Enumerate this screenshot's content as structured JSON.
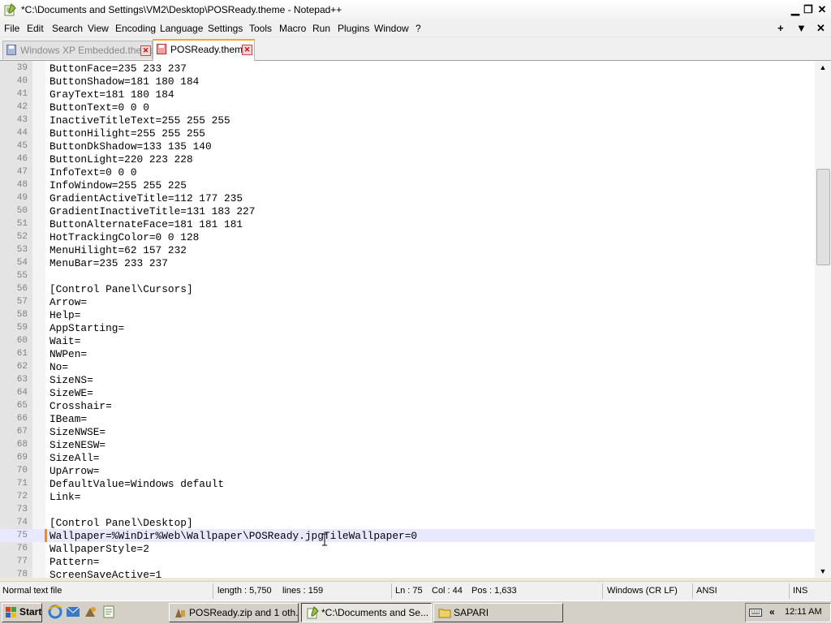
{
  "window": {
    "title": "*C:\\Documents and Settings\\VM2\\Desktop\\POSReady.theme - Notepad++",
    "minimize_icon": "minimize-icon",
    "restore_icon": "restore-icon",
    "close_icon": "close-icon"
  },
  "menu": {
    "items": [
      "File",
      "Edit",
      "Search",
      "View",
      "Encoding",
      "Language",
      "Settings",
      "Tools",
      "Macro",
      "Run",
      "Plugins",
      "Window",
      "?"
    ],
    "right_icons": [
      "plus-icon",
      "down-triangle-icon",
      "close-icon"
    ]
  },
  "tabs": [
    {
      "label": "Windows XP Embedded.theme",
      "active": false
    },
    {
      "label": "POSReady.theme",
      "active": true
    }
  ],
  "editor": {
    "current_line": 75,
    "lines": [
      {
        "n": "39",
        "text": "ButtonFace=235 233 237"
      },
      {
        "n": "40",
        "text": "ButtonShadow=181 180 184"
      },
      {
        "n": "41",
        "text": "GrayText=181 180 184"
      },
      {
        "n": "42",
        "text": "ButtonText=0 0 0"
      },
      {
        "n": "43",
        "text": "InactiveTitleText=255 255 255"
      },
      {
        "n": "44",
        "text": "ButtonHilight=255 255 255"
      },
      {
        "n": "45",
        "text": "ButtonDkShadow=133 135 140"
      },
      {
        "n": "46",
        "text": "ButtonLight=220 223 228"
      },
      {
        "n": "47",
        "text": "InfoText=0 0 0"
      },
      {
        "n": "48",
        "text": "InfoWindow=255 255 225"
      },
      {
        "n": "49",
        "text": "GradientActiveTitle=112 177 235"
      },
      {
        "n": "50",
        "text": "GradientInactiveTitle=131 183 227"
      },
      {
        "n": "51",
        "text": "ButtonAlternateFace=181 181 181"
      },
      {
        "n": "52",
        "text": "HotTrackingColor=0 0 128"
      },
      {
        "n": "53",
        "text": "MenuHilight=62 157 232"
      },
      {
        "n": "54",
        "text": "MenuBar=235 233 237"
      },
      {
        "n": "55",
        "text": ""
      },
      {
        "n": "56",
        "text": "[Control Panel\\Cursors]"
      },
      {
        "n": "57",
        "text": "Arrow="
      },
      {
        "n": "58",
        "text": "Help="
      },
      {
        "n": "59",
        "text": "AppStarting="
      },
      {
        "n": "60",
        "text": "Wait="
      },
      {
        "n": "61",
        "text": "NWPen="
      },
      {
        "n": "62",
        "text": "No="
      },
      {
        "n": "63",
        "text": "SizeNS="
      },
      {
        "n": "64",
        "text": "SizeWE="
      },
      {
        "n": "65",
        "text": "Crosshair="
      },
      {
        "n": "66",
        "text": "IBeam="
      },
      {
        "n": "67",
        "text": "SizeNWSE="
      },
      {
        "n": "68",
        "text": "SizeNESW="
      },
      {
        "n": "69",
        "text": "SizeAll="
      },
      {
        "n": "70",
        "text": "UpArrow="
      },
      {
        "n": "71",
        "text": "DefaultValue=Windows default"
      },
      {
        "n": "72",
        "text": "Link="
      },
      {
        "n": "73",
        "text": ""
      },
      {
        "n": "74",
        "text": "[Control Panel\\Desktop]"
      },
      {
        "n": "75",
        "text": "Wallpaper=%WinDir%Web\\Wallpaper\\POSReady.jpgTileWallpaper=0"
      },
      {
        "n": "76",
        "text": "WallpaperStyle=2"
      },
      {
        "n": "77",
        "text": "Pattern="
      },
      {
        "n": "78",
        "text": "ScreenSaveActive=1"
      }
    ]
  },
  "statusbar": {
    "file_type": "Normal text file",
    "length": "length : 5,750",
    "lines": "lines : 159",
    "ln": "Ln : 75",
    "col": "Col : 44",
    "pos": "Pos : 1,633",
    "eol": "Windows (CR LF)",
    "encoding": "ANSI",
    "mode": "INS"
  },
  "taskbar": {
    "start_label": "Start",
    "quicklaunch": [
      "ie-icon",
      "outlook-icon",
      "explorer-icon",
      "notepad-icon"
    ],
    "buttons": [
      {
        "label": "POSReady.zip and 1 oth...",
        "icon": "winzip-icon",
        "active": false
      },
      {
        "label": "*C:\\Documents and Se...",
        "icon": "notepadpp-icon",
        "active": true
      },
      {
        "label": "SAPARI",
        "icon": "folder-icon",
        "active": false
      }
    ],
    "clock": "12:11 AM"
  },
  "colors": {
    "current_line_bg": "#e8e8ff",
    "change_marker": "#ff8c00",
    "active_tab_accent": "#f5a623"
  }
}
